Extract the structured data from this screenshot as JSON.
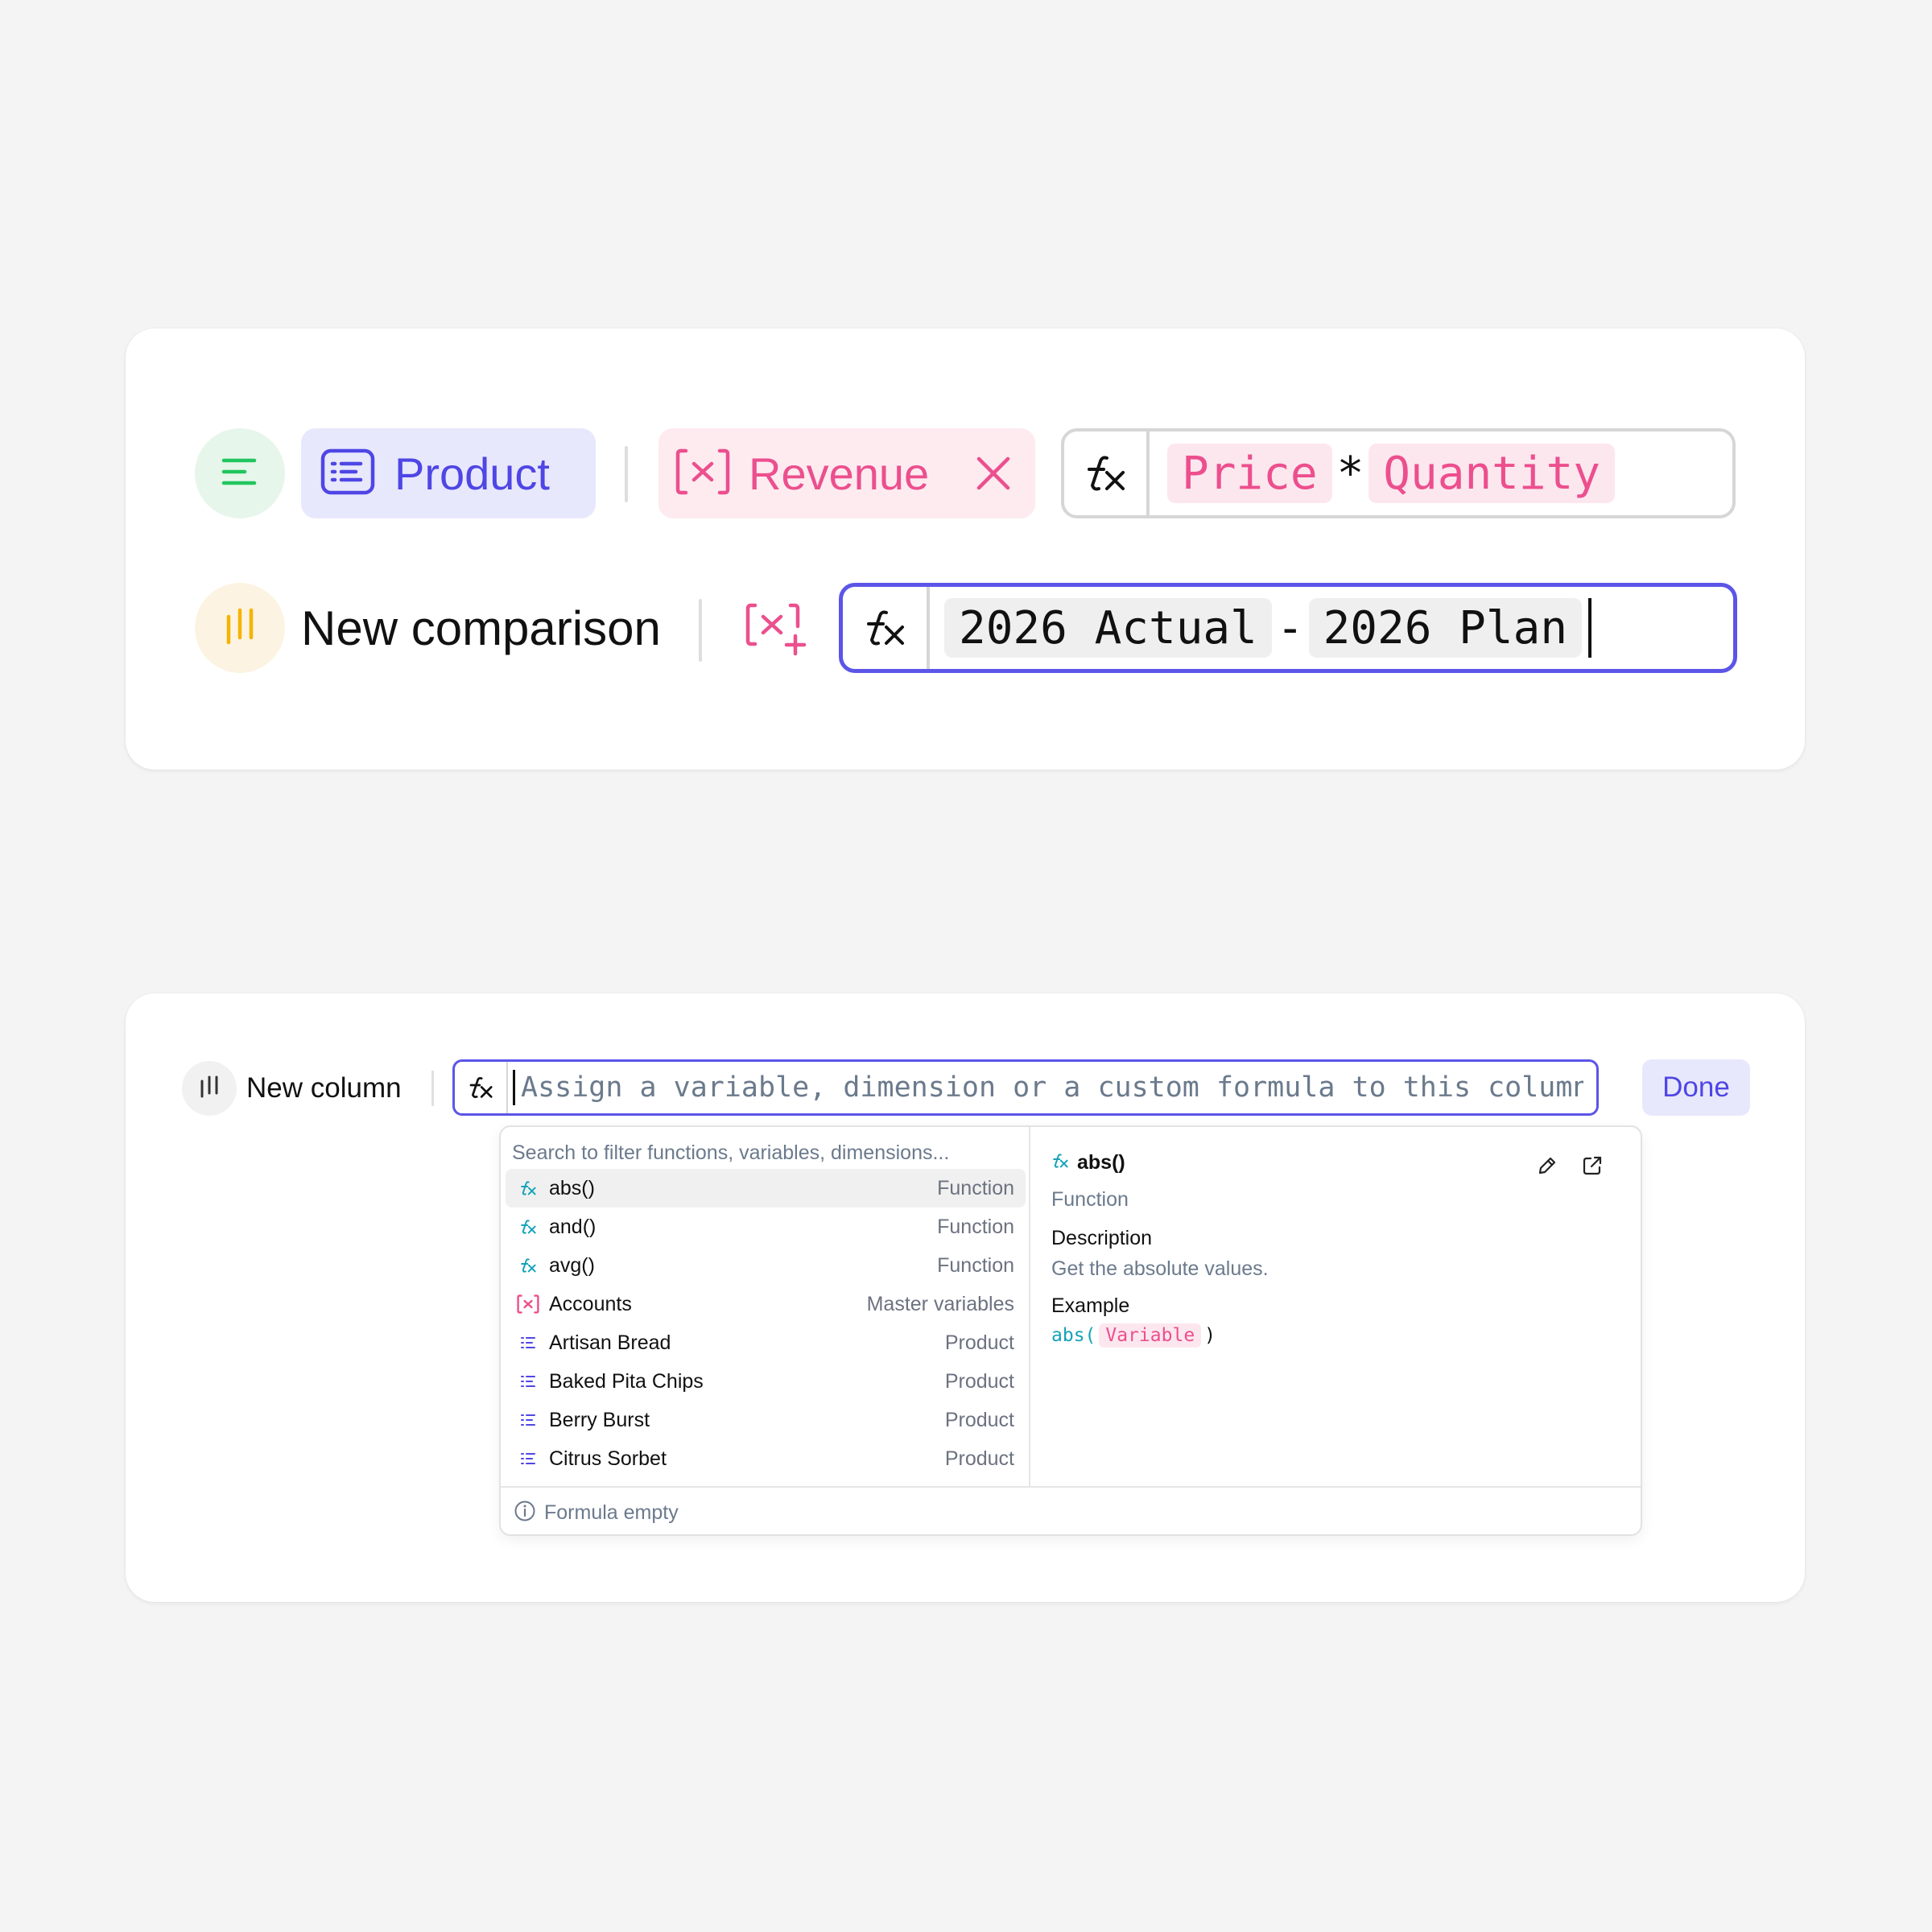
{
  "top_card": {
    "row1": {
      "dimension_icon": "list-lines-icon",
      "dimension_chip": {
        "label": "Product",
        "icon": "list-card-icon"
      },
      "variable_chip": {
        "label": "Revenue",
        "icon": "variable-x-icon",
        "close_icon": "close-icon"
      },
      "formula": {
        "fx_icon": "fx-icon",
        "tokens": [
          {
            "text": "Price",
            "kind": "variable"
          },
          {
            "text": "*",
            "kind": "operator"
          },
          {
            "text": "Quantity",
            "kind": "variable"
          }
        ]
      }
    },
    "row2": {
      "comparison_icon": "comparison-bars-icon",
      "label": "New comparison",
      "add_variable_icon": "add-variable-icon",
      "formula": {
        "fx_icon": "fx-icon",
        "tokens": [
          {
            "text": "2026 Actual",
            "kind": "scenario"
          },
          {
            "text": "-",
            "kind": "operator"
          },
          {
            "text": "2026 Plan",
            "kind": "scenario"
          }
        ]
      }
    }
  },
  "bottom_card": {
    "column_icon": "comparison-bars-icon",
    "label": "New column",
    "formula_placeholder": "Assign a variable, dimension or a custom formula to this column",
    "formula_value": "",
    "done_label": "Done",
    "dropdown": {
      "search_placeholder": "Search to filter functions, variables, dimensions...",
      "items": [
        {
          "name": "abs()",
          "kind": "Function",
          "icon": "fx-icon",
          "active": true
        },
        {
          "name": "and()",
          "kind": "Function",
          "icon": "fx-icon"
        },
        {
          "name": "avg()",
          "kind": "Function",
          "icon": "fx-icon"
        },
        {
          "name": "Accounts",
          "kind": "Master variables",
          "icon": "variable-x-icon"
        },
        {
          "name": "Artisan Bread",
          "kind": "Product",
          "icon": "list-lines-icon"
        },
        {
          "name": "Baked Pita Chips",
          "kind": "Product",
          "icon": "list-lines-icon"
        },
        {
          "name": "Berry Burst",
          "kind": "Product",
          "icon": "list-lines-icon"
        },
        {
          "name": "Citrus Sorbet",
          "kind": "Product",
          "icon": "list-lines-icon"
        }
      ],
      "detail": {
        "title": "abs()",
        "kind": "Function",
        "description_label": "Description",
        "description": "Get the absolute values.",
        "example_label": "Example",
        "example_fn": "abs(",
        "example_arg": "Variable",
        "example_close": ")",
        "edit_icon": "pencil-icon",
        "open_icon": "external-link-icon"
      },
      "footer": {
        "icon": "info-icon",
        "text": "Formula empty"
      }
    }
  },
  "colors": {
    "accent": "#4f46e5",
    "accent_border": "#5b55e8",
    "variable_pink": "#ec4f8e",
    "dimension_green": "#22c55e",
    "comparison_amber": "#f5b400",
    "function_teal": "#14a3b8"
  }
}
